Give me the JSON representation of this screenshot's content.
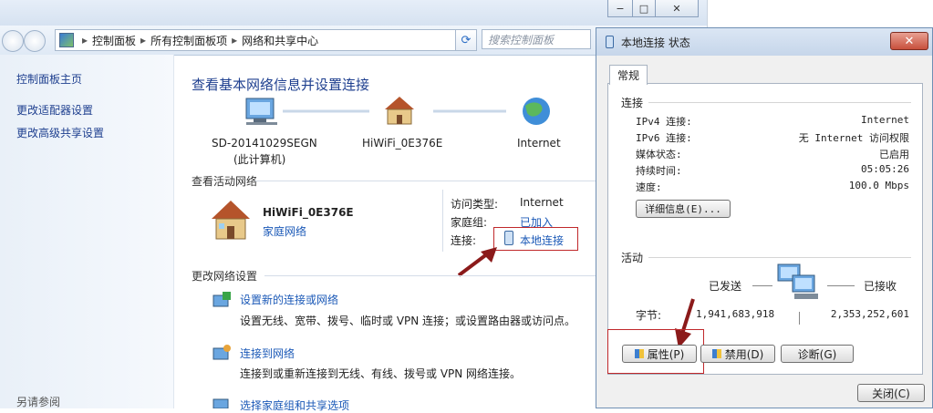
{
  "window": {
    "min_label": "−",
    "max_label": "□",
    "close_label": "✕"
  },
  "address": {
    "segments": [
      "控制面板",
      "所有控制面板项",
      "网络和共享中心"
    ],
    "separator": "▸",
    "search_placeholder": "搜索控制面板"
  },
  "sidebar": {
    "items": [
      {
        "label": "控制面板主页"
      },
      {
        "label": "更改适配器设置"
      },
      {
        "label": "更改高级共享设置"
      }
    ],
    "see_also": "另请参阅"
  },
  "main": {
    "heading": "查看基本网络信息并设置连接",
    "nodes": [
      {
        "name": "SD-20141029SEGN",
        "sub": "(此计算机)"
      },
      {
        "name": "HiWiFi_0E376E",
        "sub": ""
      },
      {
        "name": "Internet",
        "sub": ""
      }
    ],
    "active_section": "查看活动网络",
    "active_network": {
      "name": "HiWiFi_0E376E",
      "type_link": "家庭网络",
      "access_label": "访问类型:",
      "access_value": "Internet",
      "homegroup_label": "家庭组:",
      "homegroup_value": "已加入",
      "connection_label": "连接:",
      "connection_value": "本地连接"
    },
    "change_section": "更改网络设置",
    "tasks": [
      {
        "title": "设置新的连接或网络",
        "desc": "设置无线、宽带、拨号、临时或 VPN 连接；或设置路由器或访问点。"
      },
      {
        "title": "连接到网络",
        "desc": "连接到或重新连接到无线、有线、拨号或 VPN 网络连接。"
      },
      {
        "title": "选择家庭组和共享选项",
        "desc": ""
      }
    ]
  },
  "dialog": {
    "title": "本地连接 状态",
    "close_label": "✕",
    "tab": "常规",
    "connection_section": "连接",
    "rows": [
      {
        "label": "IPv4 连接:",
        "value": "Internet"
      },
      {
        "label": "IPv6 连接:",
        "value": "无 Internet 访问权限"
      },
      {
        "label": "媒体状态:",
        "value": "已启用"
      },
      {
        "label": "持续时间:",
        "value": "05:05:26"
      },
      {
        "label": "速度:",
        "value": "100.0 Mbps"
      }
    ],
    "details_button": "详细信息(E)...",
    "activity_section": "活动",
    "sent_label": "已发送",
    "received_label": "已接收",
    "bytes_label": "字节:",
    "bytes_sent": "1,941,683,918",
    "bytes_received": "2,353,252,601",
    "properties_button": "属性(P)",
    "disable_button": "禁用(D)",
    "diagnose_button": "诊断(G)",
    "close_button": "关闭(C)"
  },
  "colors": {
    "accent_link": "#1b59b7",
    "highlight_red": "#c0282b",
    "arrow": "#8b1a1a"
  }
}
